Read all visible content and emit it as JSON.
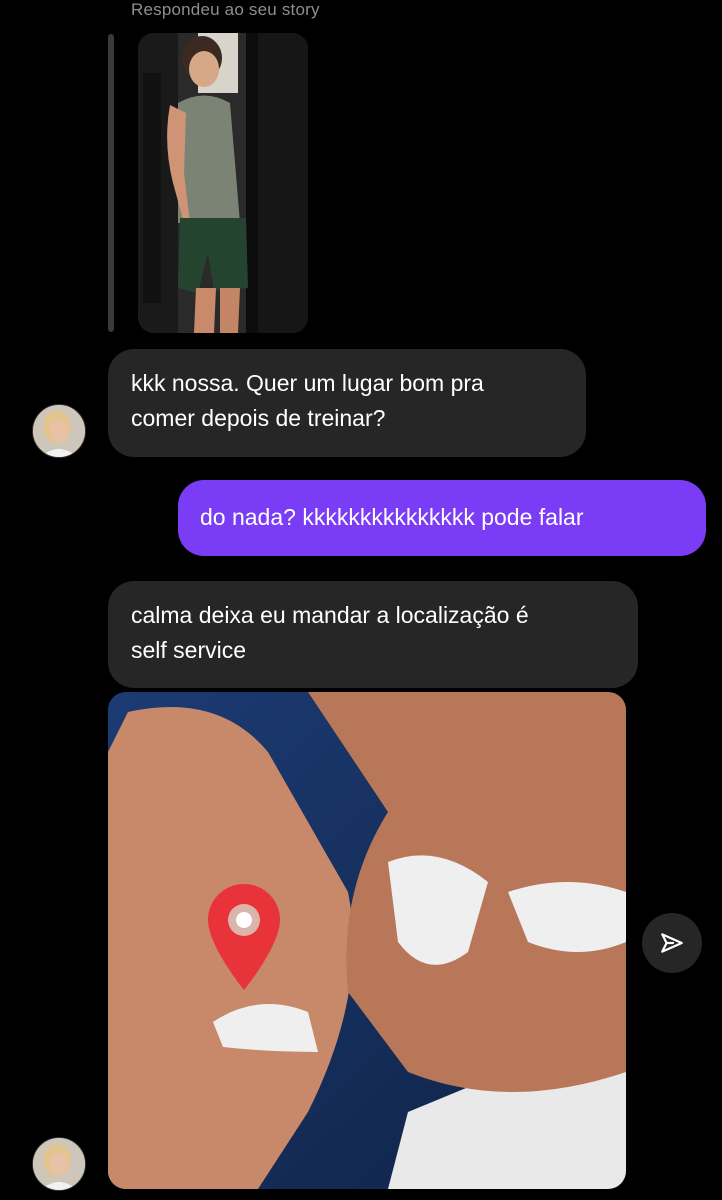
{
  "story_reply": {
    "header": "Respondeu ao seu story"
  },
  "messages": [
    {
      "direction": "in",
      "text_lines": [
        "kkk nossa. Quer um lugar bom pra",
        "comer depois de treinar?"
      ]
    },
    {
      "direction": "out",
      "text": "do nada? kkkkkkkkkkkkkkk pode falar"
    },
    {
      "direction": "in",
      "text_lines": [
        "calma deixa eu mandar a localização é",
        "self service"
      ]
    }
  ],
  "icons": {
    "share": "send-icon",
    "location": "location-pin-icon"
  },
  "colors": {
    "background": "#000000",
    "incoming_bubble": "#262626",
    "outgoing_bubble": "#7b3cf5",
    "meta_text": "#8e8e8e",
    "pin": "#e8333a"
  }
}
